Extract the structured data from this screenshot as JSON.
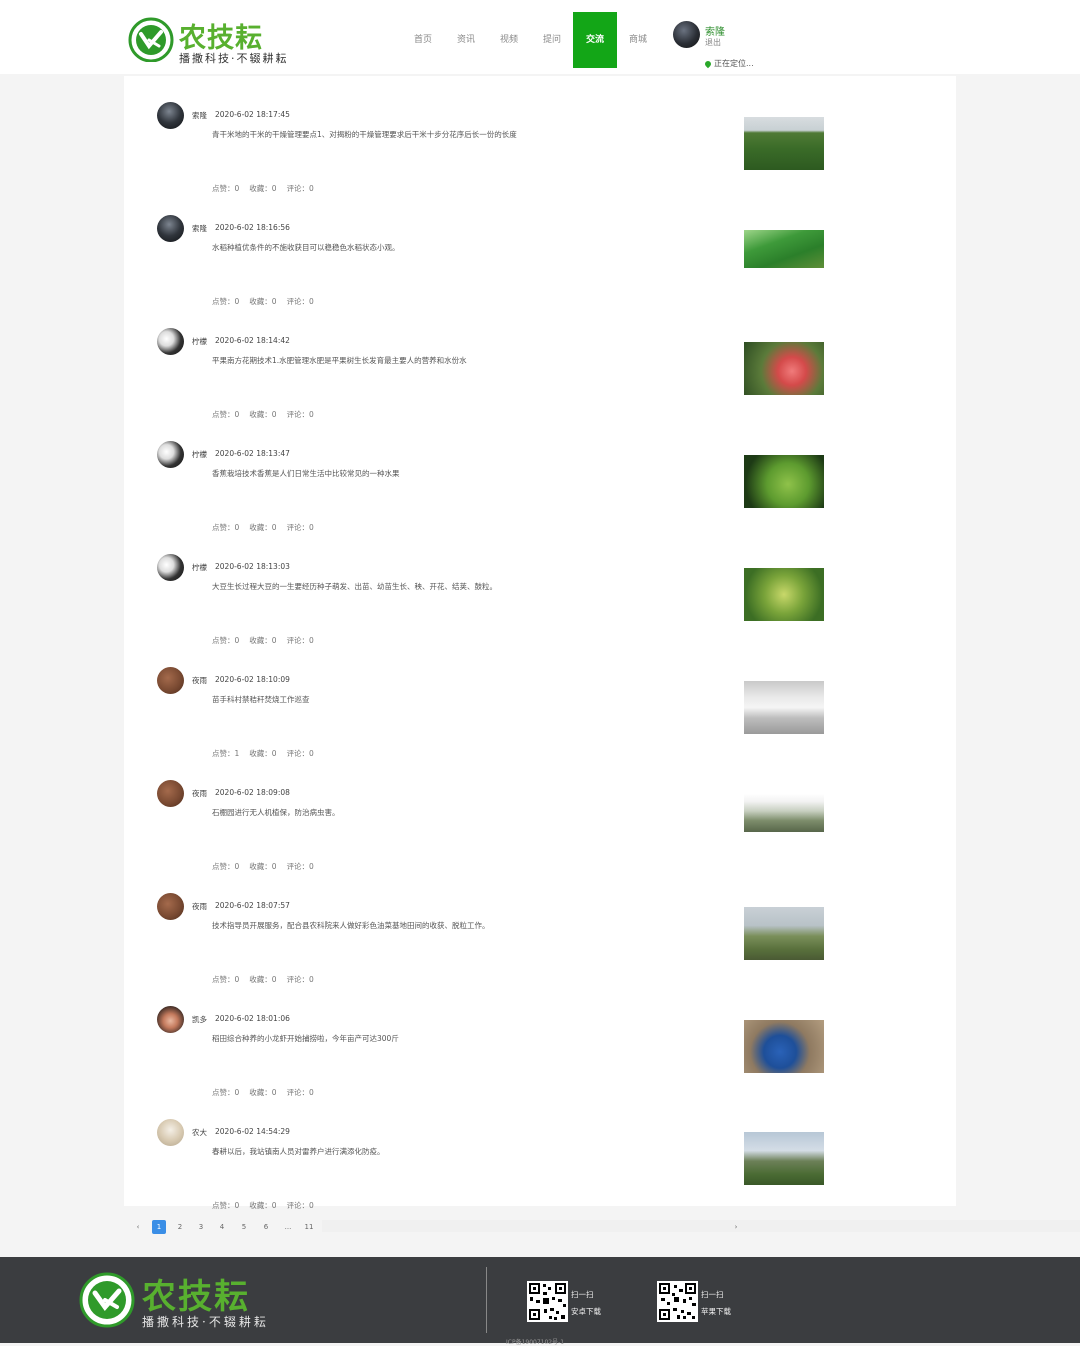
{
  "header": {
    "logo_title": "农技耘",
    "logo_slogan": "播撒科技·不辍耕耘",
    "nav": [
      "首页",
      "资讯",
      "视频",
      "提问",
      "交流",
      "商城"
    ],
    "active_nav": "交流",
    "user_name": "索隆",
    "user_logout": "退出",
    "locating": "正在定位..."
  },
  "posts": [
    {
      "user": "索隆",
      "time": "2020-6-02 18:17:45",
      "text": "青干米地的干米的干燥管理要点1、对揭粉的干燥管理要求后干米十步分花序后长一份的长度",
      "likes": "点赞：0",
      "favs": "收藏：0",
      "comments": "评论：0",
      "image": "corn-field-photo"
    },
    {
      "user": "索隆",
      "time": "2020-6-02 18:16:56",
      "text": "水稻种植优条件的不施收获目可以稳稳色水稻状态小观。",
      "likes": "点赞：0",
      "favs": "收藏：0",
      "comments": "评论：0",
      "image": "rice-field-photo"
    },
    {
      "user": "柠檬",
      "time": "2020-6-02 18:14:42",
      "text": "平果南方花期技术1.水肥管理水肥是平果树生长发育最主要人的营养和水份水",
      "likes": "点赞：0",
      "favs": "收藏：0",
      "comments": "评论：0",
      "image": "peach-tree-photo"
    },
    {
      "user": "柠檬",
      "time": "2020-6-02 18:13:47",
      "text": "香蕉栽培技术香蕉是人们日常生活中比较常见的一种水果",
      "likes": "点赞：0",
      "favs": "收藏：0",
      "comments": "评论：0",
      "image": "banana-photo"
    },
    {
      "user": "柠檬",
      "time": "2020-6-02 18:13:03",
      "text": "大豆生长过程大豆的一生要经历种子萌发、出苗、幼苗生长、秧、开花、结荚、鼓粒。",
      "likes": "点赞：0",
      "favs": "收藏：0",
      "comments": "评论：0",
      "image": "soybean-photo"
    },
    {
      "user": "夜雨",
      "time": "2020-6-02 18:10:09",
      "text": "苗手科村禁秸秆焚烧工作巡查",
      "likes": "点赞：1",
      "favs": "收藏：0",
      "comments": "评论：0",
      "image": "patrol-car-photo"
    },
    {
      "user": "夜雨",
      "time": "2020-6-02 18:09:08",
      "text": "石棚园进行无人机植保，防治病虫害。",
      "likes": "点赞：0",
      "favs": "收藏：0",
      "comments": "评论：0",
      "image": "drone-hill-photo"
    },
    {
      "user": "夜雨",
      "time": "2020-6-02 18:07:57",
      "text": "技术指导员开展服务，配合县农科院来人做好彩色油菜基地田间的收获、脱粒工作。",
      "likes": "点赞：0",
      "favs": "收藏：0",
      "comments": "评论：0",
      "image": "farmers-field-photo"
    },
    {
      "user": "凯多",
      "time": "2020-6-02 18:01:06",
      "text": "稻田综合种养的小龙虾开始捕捞啦，今年亩产可达300斤",
      "likes": "点赞：0",
      "favs": "收藏：0",
      "comments": "评论：0",
      "image": "crayfish-bucket-photo"
    },
    {
      "user": "农大",
      "time": "2020-6-02 14:54:29",
      "text": "春耕以后，我站镇南人员对雷养户进行满添化防疫。",
      "likes": "点赞：0",
      "favs": "收藏：0",
      "comments": "评论：0",
      "image": "bridge-field-photo"
    }
  ],
  "pagination": {
    "prev": "‹",
    "pages": [
      "1",
      "2",
      "3",
      "4",
      "5",
      "6",
      "...",
      "11"
    ],
    "current": "1",
    "next": "›"
  },
  "footer": {
    "logo_title": "农技耘",
    "logo_slogan": "播撒科技·不辍耕耘",
    "qr": [
      {
        "line1": "扫一扫",
        "line2": "安卓下载"
      },
      {
        "line1": "扫一扫",
        "line2": "苹果下载"
      }
    ],
    "copyright": "ICP备19007102号-1"
  },
  "colors": {
    "brand_green": "#58b02f",
    "nav_active": "#13a617",
    "page_active": "#3a8ee6",
    "footer_bg": "#3b3d40"
  }
}
